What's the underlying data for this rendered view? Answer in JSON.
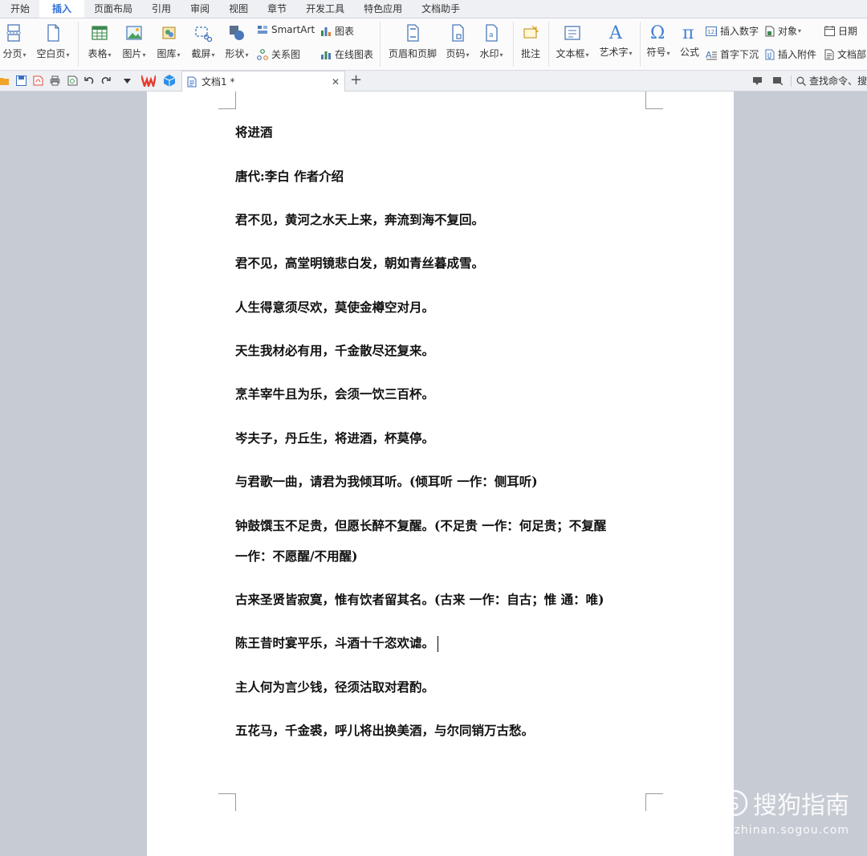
{
  "menu": {
    "tabs": [
      "开始",
      "插入",
      "页面布局",
      "引用",
      "审阅",
      "视图",
      "章节",
      "开发工具",
      "特色应用",
      "文档助手"
    ],
    "active": "插入"
  },
  "ribbon": {
    "fenye": "分页",
    "kongbaiye": "空白页",
    "biaoge": "表格",
    "tupian": "图片",
    "tuku": "图库",
    "jieping": "截屏",
    "xingzhuang": "形状",
    "smartart": "SmartArt",
    "guanxitu": "关系图",
    "tubiao": "图表",
    "zaixiantubiao": "在线图表",
    "yemei": "页眉和页脚",
    "yema": "页码",
    "shuiyin": "水印",
    "pizhu": "批注",
    "wenbenkuang": "文本框",
    "yishuzi": "艺术字",
    "fuhao": "符号",
    "gongshi": "公式",
    "charushuzi": "插入数字",
    "shouzixiachen": "首字下沉",
    "duixiang": "对象",
    "charufujian": "插入附件",
    "riqi": "日期",
    "wendangbu": "文档部"
  },
  "toolbar": {
    "doc_tab": "文档1 *",
    "search_command": "查找命令、搜"
  },
  "document": {
    "lines": [
      "将进酒",
      "唐代:李白 作者介绍",
      "君不见，黄河之水天上来，奔流到海不复回。",
      "君不见，高堂明镜悲白发，朝如青丝暮成雪。",
      "人生得意须尽欢，莫使金樽空对月。",
      "天生我材必有用，千金散尽还复来。",
      "烹羊宰牛且为乐，会须一饮三百杯。",
      "岑夫子，丹丘生，将进酒，杯莫停。",
      "与君歌一曲，请君为我倾耳听。(倾耳听  一作：侧耳听)",
      "钟鼓馔玉不足贵，但愿长醉不复醒。(不足贵  一作：何足贵；不复醒",
      "一作：不愿醒/不用醒)",
      "古来圣贤皆寂寞，惟有饮者留其名。(古来  一作：自古；惟  通：唯)",
      "陈王昔时宴平乐，斗酒十千恣欢谑。",
      "主人何为言少钱，径须沽取对君酌。",
      "五花马，千金裘，呼儿将出换美酒，与尔同销万古愁。"
    ]
  },
  "watermark": {
    "brand": "搜狗指南",
    "url": "zhinan.sogou.com"
  }
}
